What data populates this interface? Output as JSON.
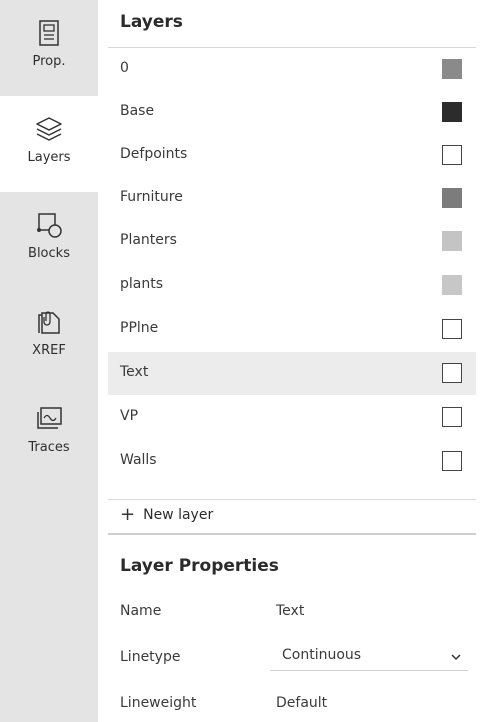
{
  "rail": {
    "items": [
      {
        "label": "Prop.",
        "icon": "properties-icon"
      },
      {
        "label": "Layers",
        "icon": "layers-icon"
      },
      {
        "label": "Blocks",
        "icon": "blocks-icon"
      },
      {
        "label": "XREF",
        "icon": "xref-icon"
      },
      {
        "label": "Traces",
        "icon": "traces-icon"
      }
    ],
    "active": "Layers"
  },
  "layers": {
    "title": "Layers",
    "items": [
      {
        "name": "0",
        "color": "#8a8a8a"
      },
      {
        "name": "Base",
        "color": "#2c2c2c"
      },
      {
        "name": "Defpoints",
        "color": "#ffffff"
      },
      {
        "name": "Furniture",
        "color": "#7c7c7c"
      },
      {
        "name": "Planters",
        "color": "#c4c4c4"
      },
      {
        "name": "plants",
        "color": "#c7c7c7"
      },
      {
        "name": "PPlne",
        "color": "#ffffff"
      },
      {
        "name": "Text",
        "color": "#ffffff"
      },
      {
        "name": "VP",
        "color": "#ffffff"
      },
      {
        "name": "Walls",
        "color": "#ffffff"
      }
    ],
    "selected": "Text",
    "new_layer_label": "New layer"
  },
  "layer_properties": {
    "title": "Layer Properties",
    "name_label": "Name",
    "name_value": "Text",
    "linetype_label": "Linetype",
    "linetype_value": "Continuous",
    "lineweight_label": "Lineweight",
    "lineweight_value": "Default"
  }
}
